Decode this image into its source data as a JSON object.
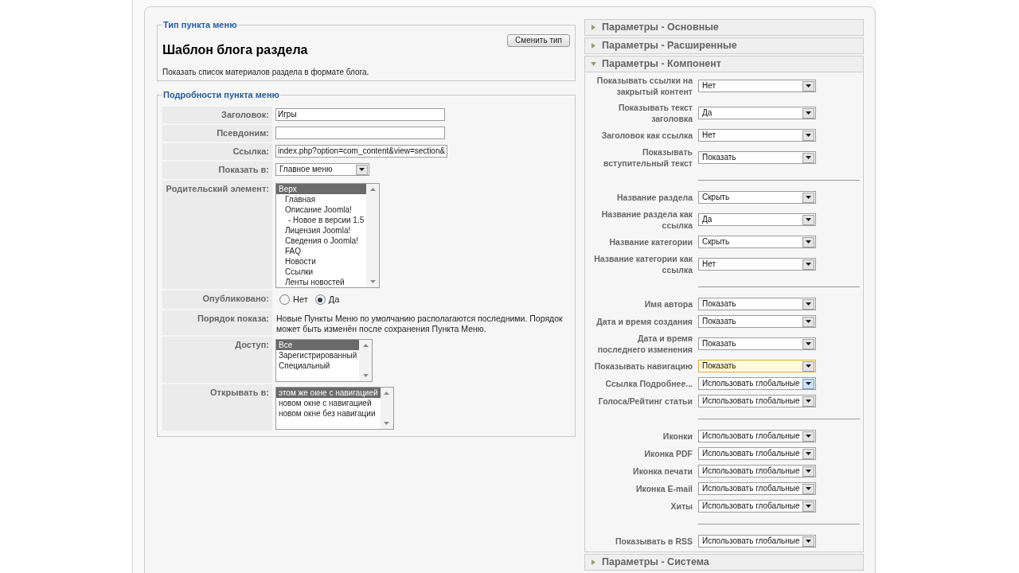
{
  "menu_type": {
    "legend": "Тип пункта меню",
    "change_button": "Сменить тип",
    "title": "Шаблон блога раздела",
    "description": "Показать список материалов раздела в формате блога."
  },
  "menu_item_details": {
    "legend": "Подробности пункта меню",
    "fields": [
      {
        "kind": "text",
        "label": "Заголовок:",
        "value": "Игры"
      },
      {
        "kind": "text",
        "label": "Псевдоним:"
      },
      {
        "kind": "text",
        "label": "Ссылка:",
        "value": "index.php?option=com_content&view=section&"
      },
      {
        "kind": "select",
        "label": "Показать в:",
        "value": "Главное меню"
      },
      {
        "kind": "listbox",
        "label": "Родительский элемент:",
        "options": [
          {
            "label": "Верх",
            "selected": true,
            "children": [
              {
                "label": "Главная",
                "selected": false
              },
              {
                "label": "Описание Joomla!",
                "selected": false,
                "children": [
                  {
                    "label": "- Новое в версии 1.5",
                    "selected": false
                  }
                ]
              },
              {
                "label": "Лицензия Joomla!",
                "selected": false
              },
              {
                "label": "Сведения о Joomla!",
                "selected": false
              },
              {
                "label": "FAQ",
                "selected": false
              },
              {
                "label": "Новости",
                "selected": false
              },
              {
                "label": "Ссылки",
                "selected": false
              },
              {
                "label": "Ленты новостей",
                "selected": false
              }
            ]
          }
        ]
      },
      {
        "kind": "radio",
        "label": "Опубликовано:",
        "options": [
          {
            "label": "Нет",
            "selected": false
          },
          {
            "label": "Да",
            "selected": true
          }
        ]
      },
      {
        "kind": "note",
        "label": "Порядок показа:",
        "text": "Новые Пункты Меню по умолчанию располагаются последними. Порядок может быть изменён после сохранения Пункта Меню."
      },
      {
        "kind": "listbox",
        "label": "Доступ:",
        "options": [
          {
            "label": "Все",
            "selected": true
          },
          {
            "label": "Зарегистрированный",
            "selected": false
          },
          {
            "label": "Специальный",
            "selected": false
          }
        ]
      },
      {
        "kind": "listbox",
        "label": "Открывать в:",
        "options": [
          {
            "label": "этом же окне с навигацией",
            "selected": true
          },
          {
            "label": "новом окне с навигацией",
            "selected": false
          },
          {
            "label": "новом окне без навигации",
            "selected": false
          }
        ]
      }
    ]
  },
  "parameter_panels": [
    {
      "title": "Параметры - Основные",
      "expanded": false
    },
    {
      "title": "Параметры - Расширенные",
      "expanded": false
    },
    {
      "title": "Параметры - Компонент",
      "expanded": true,
      "params": [
        {
          "kind": "select",
          "label": "Показывать ссылки на закрытый контент",
          "value": "Нет",
          "focused": false,
          "hovered": false
        },
        {
          "kind": "select",
          "label": "Показывать текст заголовка",
          "value": "Да",
          "focused": false,
          "hovered": false
        },
        {
          "kind": "select",
          "label": "Заголовок как ссылка",
          "value": "Нет",
          "focused": false,
          "hovered": false
        },
        {
          "kind": "select",
          "label": "Показывать вступительный текст",
          "value": "Показать",
          "focused": false,
          "hovered": false
        },
        {
          "kind": "separator"
        },
        {
          "kind": "select",
          "label": "Название раздела",
          "value": "Скрыть",
          "focused": false,
          "hovered": false
        },
        {
          "kind": "select",
          "label": "Название раздела как ссылка",
          "value": "Да",
          "focused": false,
          "hovered": false
        },
        {
          "kind": "select",
          "label": "Название категории",
          "value": "Скрыть",
          "focused": false,
          "hovered": false
        },
        {
          "kind": "select",
          "label": "Название категории как ссылка",
          "value": "Нет",
          "focused": false,
          "hovered": false
        },
        {
          "kind": "separator"
        },
        {
          "kind": "select",
          "label": "Имя автора",
          "value": "Показать",
          "focused": false,
          "hovered": false
        },
        {
          "kind": "select",
          "label": "Дата и время создания",
          "value": "Показать",
          "focused": false,
          "hovered": false
        },
        {
          "kind": "select",
          "label": "Дата и время последнего изменения",
          "value": "Показать",
          "focused": false,
          "hovered": false
        },
        {
          "kind": "select",
          "label": "Показывать навигацию",
          "value": "Показать",
          "focused": true,
          "hovered": false
        },
        {
          "kind": "select",
          "label": "Ссылка Подробнее...",
          "value": "Использовать глобальные",
          "focused": false,
          "hovered": true
        },
        {
          "kind": "select",
          "label": "Голоса/Рейтинг статьи",
          "value": "Использовать глобальные",
          "focused": false,
          "hovered": false
        },
        {
          "kind": "separator"
        },
        {
          "kind": "select",
          "label": "Иконки",
          "value": "Использовать глобальные",
          "focused": false,
          "hovered": false
        },
        {
          "kind": "select",
          "label": "Иконка PDF",
          "value": "Использовать глобальные",
          "focused": false,
          "hovered": false
        },
        {
          "kind": "select",
          "label": "Иконка печати",
          "value": "Использовать глобальные",
          "focused": false,
          "hovered": false
        },
        {
          "kind": "select",
          "label": "Иконка E-mail",
          "value": "Использовать глобальные",
          "focused": false,
          "hovered": false
        },
        {
          "kind": "select",
          "label": "Хиты",
          "value": "Использовать глобальные",
          "focused": false,
          "hovered": false
        },
        {
          "kind": "separator"
        },
        {
          "kind": "select",
          "label": "Показывать в RSS",
          "value": "Использовать глобальные",
          "focused": false,
          "hovered": false
        }
      ]
    },
    {
      "title": "Параметры - Система",
      "expanded": false
    }
  ]
}
